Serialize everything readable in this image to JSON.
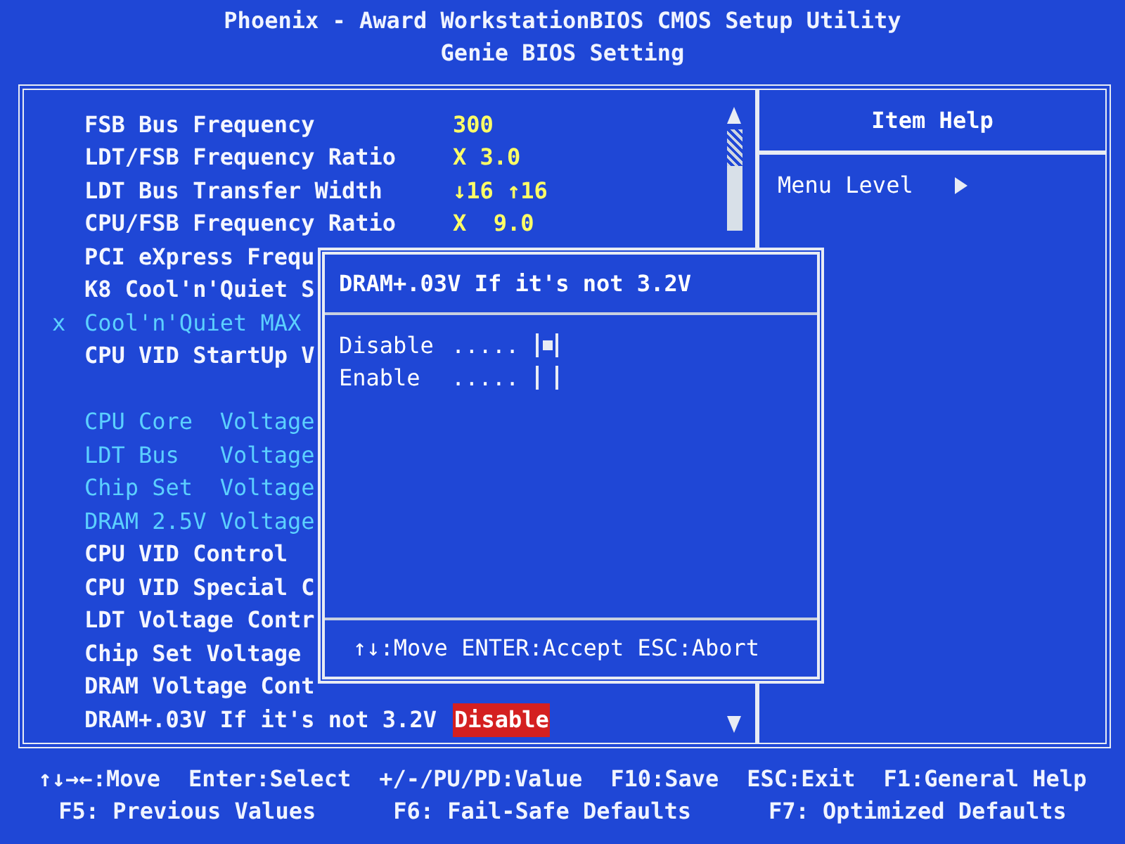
{
  "header": {
    "title": "Phoenix - Award WorkstationBIOS CMOS Setup Utility",
    "subtitle": "Genie BIOS Setting"
  },
  "items": [
    {
      "kind": "setting",
      "label": "FSB Bus Frequency",
      "value": "300",
      "dimmed": false
    },
    {
      "kind": "setting",
      "label": "LDT/FSB Frequency Ratio",
      "value": "X 3.0",
      "dimmed": false
    },
    {
      "kind": "setting",
      "label": "LDT Bus Transfer Width",
      "value": "↓16 ↑16",
      "dimmed": false
    },
    {
      "kind": "setting",
      "label": "CPU/FSB Frequency Ratio",
      "value": "X  9.0",
      "dimmed": false
    },
    {
      "kind": "setting",
      "label": "PCI eXpress Frequ",
      "dimmed": false
    },
    {
      "kind": "setting",
      "label": "K8 Cool'n'Quiet S",
      "dimmed": false
    },
    {
      "kind": "setting",
      "label": "Cool'n'Quiet MAX",
      "marker": "x",
      "dimmed": true
    },
    {
      "kind": "setting",
      "label": "CPU VID StartUp V",
      "dimmed": false
    },
    {
      "kind": "gap"
    },
    {
      "kind": "setting",
      "label": "CPU Core  Voltage",
      "dimmed": true
    },
    {
      "kind": "setting",
      "label": "LDT Bus   Voltage",
      "dimmed": true
    },
    {
      "kind": "setting",
      "label": "Chip Set  Voltage",
      "dimmed": true
    },
    {
      "kind": "setting",
      "label": "DRAM 2.5V Voltage",
      "dimmed": true
    },
    {
      "kind": "setting",
      "label": "CPU VID Control",
      "dimmed": false
    },
    {
      "kind": "setting",
      "label": "CPU VID Special C",
      "dimmed": false
    },
    {
      "kind": "setting",
      "label": "LDT Voltage Contr",
      "dimmed": false
    },
    {
      "kind": "setting",
      "label": "Chip Set Voltage",
      "dimmed": false
    },
    {
      "kind": "setting",
      "label": "DRAM Voltage Cont",
      "dimmed": false
    },
    {
      "kind": "setting",
      "label": "DRAM+.03V If it's not 3.2V",
      "value": "Disable",
      "dimmed": false,
      "selected": true
    }
  ],
  "help": {
    "title": "Item Help",
    "menu_level": "Menu Level"
  },
  "dialog": {
    "title": "DRAM+.03V If it's not 3.2V",
    "options": [
      {
        "label": "Disable",
        "leader": ".....",
        "checked": true
      },
      {
        "label": "Enable",
        "leader": ".....",
        "checked": false
      }
    ],
    "hint": "↑↓:Move ENTER:Accept ESC:Abort"
  },
  "footer": [
    [
      "↑↓→←:Move",
      "Enter:Select",
      "+/-/PU/PD:Value",
      "F10:Save",
      "ESC:Exit",
      "F1:General Help"
    ],
    [
      "F5: Previous Values",
      "F6: Fail-Safe Defaults",
      "F7: Optimized Defaults"
    ]
  ]
}
